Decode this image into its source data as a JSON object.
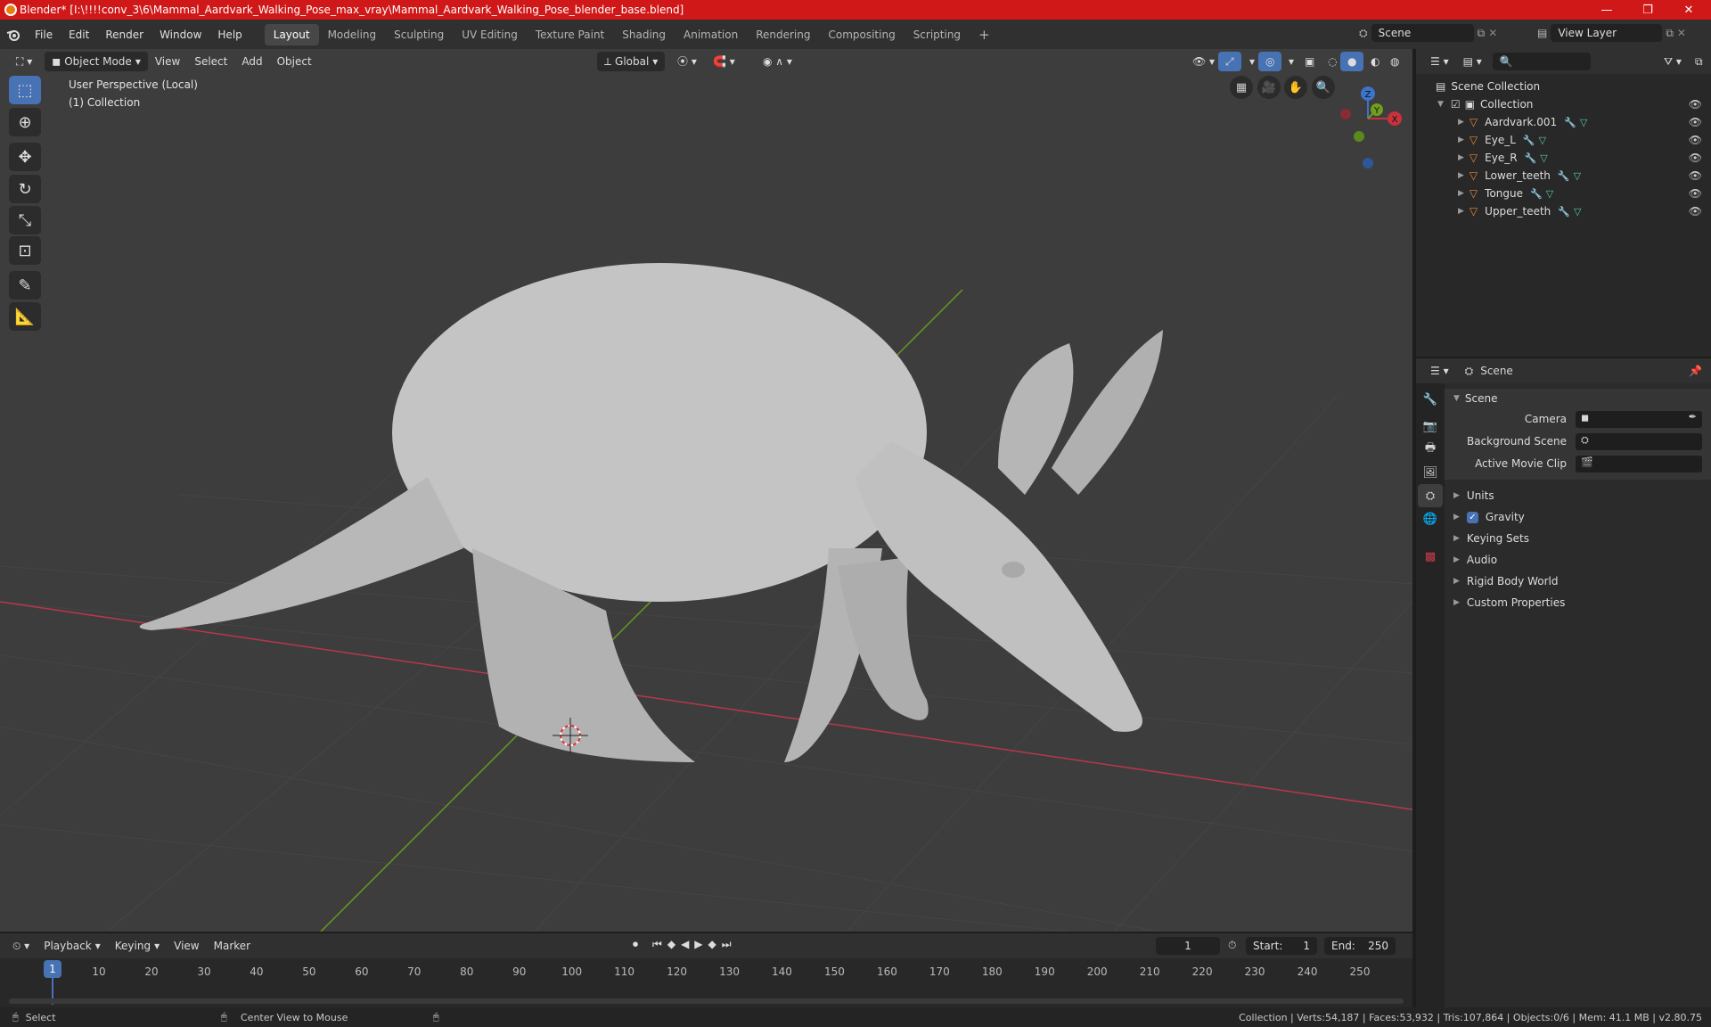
{
  "window": {
    "title": "Blender* [I:\\!!!!conv_3\\6\\Mammal_Aardvark_Walking_Pose_max_vray\\Mammal_Aardvark_Walking_Pose_blender_base.blend]",
    "minimize": "—",
    "maximize": "❐",
    "close": "✕"
  },
  "menu": [
    "File",
    "Edit",
    "Render",
    "Window",
    "Help"
  ],
  "workspaces": [
    "Layout",
    "Modeling",
    "Sculpting",
    "UV Editing",
    "Texture Paint",
    "Shading",
    "Animation",
    "Rendering",
    "Compositing",
    "Scripting"
  ],
  "active_workspace": "Layout",
  "add_workspace": "+",
  "scene_selector": "Scene",
  "view_layer_selector": "View Layer",
  "viewport": {
    "mode": "Object Mode",
    "menus": [
      "View",
      "Select",
      "Add",
      "Object"
    ],
    "transform_orientation": "Global",
    "overlay_line1": "User Perspective (Local)",
    "overlay_line2": "(1) Collection",
    "gizmo": {
      "z": "Z",
      "y": "Y",
      "x": "X"
    }
  },
  "outliner": {
    "root": "Scene Collection",
    "collection": "Collection",
    "objects": [
      "Aardvark.001",
      "Eye_L",
      "Eye_R",
      "Lower_teeth",
      "Tongue",
      "Upper_teeth"
    ]
  },
  "properties": {
    "header": "Scene",
    "panel_title": "Scene",
    "fields": {
      "camera": "Camera",
      "background_scene": "Background Scene",
      "active_movie_clip": "Active Movie Clip"
    },
    "sections": [
      "Units",
      "Gravity",
      "Keying Sets",
      "Audio",
      "Rigid Body World",
      "Custom Properties"
    ],
    "gravity_checked": true
  },
  "timeline": {
    "menus": [
      "Playback",
      "Keying",
      "View",
      "Marker"
    ],
    "current_frame": "1",
    "start_label": "Start:",
    "start": "1",
    "end_label": "End:",
    "end": "250",
    "ticks": [
      "1",
      "10",
      "20",
      "30",
      "40",
      "50",
      "60",
      "70",
      "80",
      "90",
      "100",
      "110",
      "120",
      "130",
      "140",
      "150",
      "160",
      "170",
      "180",
      "190",
      "200",
      "210",
      "220",
      "230",
      "240",
      "250"
    ]
  },
  "status": {
    "select": "Select",
    "center_view": "Center View to Mouse",
    "stats": "Collection | Verts:54,187 | Faces:53,932 | Tris:107,864 | Objects:0/6 | Mem: 41.1 MB | v2.80.75"
  },
  "colors": {
    "title_bar": "#d01818",
    "active_tool": "#4772b3",
    "x_axis": "#c8323c",
    "y_axis": "#6fa01c",
    "z_axis": "#3d74c9",
    "viewport_bg": "#3d3d3d"
  }
}
